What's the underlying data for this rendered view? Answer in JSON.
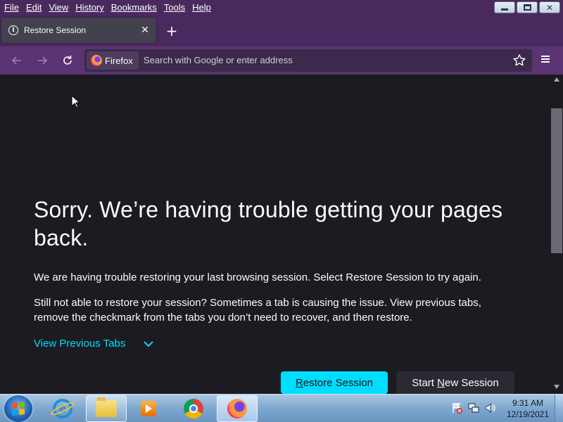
{
  "menubar": {
    "items": [
      {
        "label": "File"
      },
      {
        "label": "Edit"
      },
      {
        "label": "View"
      },
      {
        "label": "History"
      },
      {
        "label": "Bookmarks"
      },
      {
        "label": "Tools"
      },
      {
        "label": "Help"
      }
    ]
  },
  "tab": {
    "title": "Restore Session",
    "close_symbol": "✕",
    "new_tab_symbol": "+"
  },
  "navbar": {
    "identity_label": "Firefox",
    "url_placeholder": "Search with Google or enter address"
  },
  "content": {
    "headline": "Sorry. We’re having trouble getting your pages back.",
    "paragraph_1": "We are having trouble restoring your last browsing session. Select Restore Session to try again.",
    "paragraph_2": "Still not able to restore your session? Sometimes a tab is causing the issue. View previous tabs, remove the checkmark from the tabs you don’t need to recover, and then restore.",
    "view_previous_tabs": "View Previous Tabs",
    "restore_button": {
      "underlined": "R",
      "rest": "estore Session"
    },
    "new_session_button": {
      "before": "Start ",
      "underlined": "N",
      "after": "ew Session"
    }
  },
  "taskbar": {
    "time": "9:31 AM",
    "date": "12/19/2021"
  },
  "colors": {
    "titlebar": "#4a2a5e",
    "navbar": "#5b3473",
    "content_bg": "#1c1b22",
    "accent_link": "#00ddff",
    "primary_button": "#00ddff"
  }
}
